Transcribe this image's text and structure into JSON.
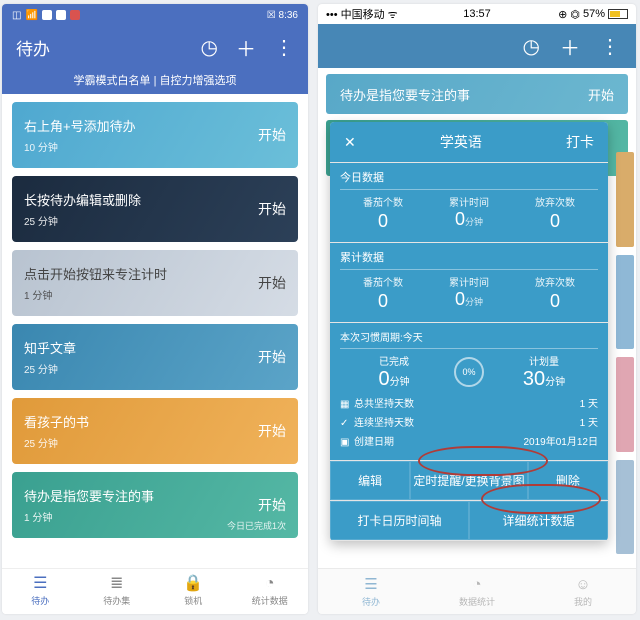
{
  "left": {
    "status": {
      "time": "8:36",
      "notif_icon": "◧",
      "extras": "⌘ ░"
    },
    "header": {
      "title": "待办"
    },
    "banner": "学霸模式白名单 | 自控力增强选项",
    "start_label": "开始",
    "cards": [
      {
        "title": "右上角+号添加待办",
        "sub": "10 分钟"
      },
      {
        "title": "长按待办编辑或删除",
        "sub": "25 分钟"
      },
      {
        "title": "点击开始按钮来专注计时",
        "sub": "1 分钟"
      },
      {
        "title": "知乎文章",
        "sub": "25 分钟"
      },
      {
        "title": "看孩子的书",
        "sub": "25 分钟"
      },
      {
        "title": "待办是指您要专注的事",
        "sub": "1 分钟",
        "extra": "今日已完成1次"
      }
    ],
    "tabs": [
      {
        "label": "待办",
        "icon": "☰",
        "active": true
      },
      {
        "label": "待办集",
        "icon": "≣"
      },
      {
        "label": "锁机",
        "icon": "🔒"
      },
      {
        "label": "统计数据",
        "icon": "◔"
      }
    ]
  },
  "right": {
    "status": {
      "carrier": "中国移动",
      "time": "13:57",
      "battery": "57%"
    },
    "bg_hint": {
      "text": "待办是指您要专注的事",
      "start": "开始"
    },
    "modal": {
      "close": "✕",
      "title": "学英语",
      "action": "打卡",
      "sec_today": {
        "label": "今日数据",
        "cols": [
          {
            "k": "番茄个数",
            "v": "0"
          },
          {
            "k": "累计时间",
            "v": "0",
            "u": "分钟"
          },
          {
            "k": "放弃次数",
            "v": "0"
          }
        ]
      },
      "sec_total": {
        "label": "累计数据",
        "cols": [
          {
            "k": "番茄个数",
            "v": "0"
          },
          {
            "k": "累计时间",
            "v": "0",
            "u": "分钟"
          },
          {
            "k": "放弃次数",
            "v": "0"
          }
        ]
      },
      "period": {
        "label": "本次习惯周期:今天",
        "done_k": "已完成",
        "done_v": "0",
        "done_u": "分钟",
        "pct": "0%",
        "plan_k": "计划量",
        "plan_v": "30",
        "plan_u": "分钟",
        "meta": [
          {
            "icon": "▦",
            "k": "总共坚持天数",
            "v": "1 天"
          },
          {
            "icon": "✓",
            "k": "连续坚持天数",
            "v": "1 天"
          },
          {
            "icon": "▣",
            "k": "创建日期",
            "v": "2019年01月12日"
          }
        ]
      },
      "btns1": [
        "编辑",
        "定时提醒/更换背景图",
        "删除"
      ],
      "btns2": [
        "打卡日历时间轴",
        "详细统计数据"
      ]
    },
    "tabs": [
      {
        "label": "待办",
        "icon": "☰",
        "active": true
      },
      {
        "label": "数据统计",
        "icon": "◔"
      },
      {
        "label": "我的",
        "icon": "☺"
      }
    ]
  }
}
